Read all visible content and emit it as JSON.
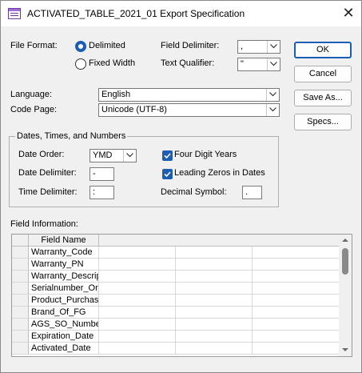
{
  "window": {
    "title": "ACTIVATED_TABLE_2021_01 Export Specification"
  },
  "file_format": {
    "label": "File Format:",
    "options": [
      {
        "label": "Delimited",
        "selected": true
      },
      {
        "label": "Fixed Width",
        "selected": false
      }
    ]
  },
  "field_delimiter": {
    "label": "Field Delimiter:",
    "value": ","
  },
  "text_qualifier": {
    "label": "Text Qualifier:",
    "value": "\""
  },
  "buttons": {
    "ok": "OK",
    "cancel": "Cancel",
    "save_as": "Save As...",
    "specs": "Specs..."
  },
  "language": {
    "label": "Language:",
    "value": "English"
  },
  "code_page": {
    "label": "Code Page:",
    "value": "Unicode (UTF-8)"
  },
  "dates_group": {
    "title": "Dates, Times, and Numbers",
    "date_order": {
      "label": "Date Order:",
      "value": "YMD"
    },
    "date_delimiter": {
      "label": "Date Delimiter:",
      "value": "-"
    },
    "time_delimiter": {
      "label": "Time Delimiter:",
      "value": ":"
    },
    "four_digit_years": {
      "label": "Four Digit Years",
      "checked": true
    },
    "leading_zeros": {
      "label": "Leading Zeros in Dates",
      "checked": true
    },
    "decimal_symbol": {
      "label": "Decimal Symbol:",
      "value": "."
    }
  },
  "field_info": {
    "label": "Field Information:",
    "column_header": "Field Name",
    "fields": [
      "Warranty_Code",
      "Warranty_PN",
      "Warranty_Descrip",
      "Serialnumber_Or_",
      "Product_Purchase",
      "Brand_Of_FG",
      "AGS_SO_Number",
      "Expiration_Date",
      "Activated_Date"
    ]
  },
  "icons": {
    "title": "table-icon",
    "close": "close-icon",
    "dropdown": "chevron-down-icon",
    "scroll_up": "scroll-up-icon",
    "scroll_down": "scroll-down-icon"
  },
  "colors": {
    "accent": "#1a5fb4",
    "dialog_bg": "#f0f0f0"
  }
}
